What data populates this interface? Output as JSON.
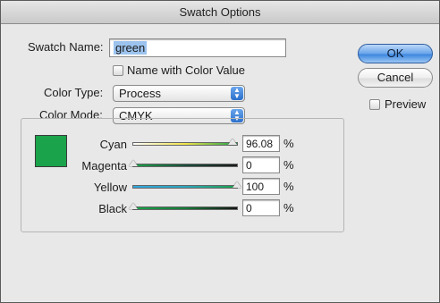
{
  "window": {
    "title": "Swatch Options"
  },
  "swatch_name": {
    "label": "Swatch Name:",
    "value": "green"
  },
  "name_with_color_value": {
    "label": "Name with Color Value",
    "checked": false
  },
  "color_type": {
    "label": "Color Type:",
    "value": "Process"
  },
  "color_mode": {
    "label": "Color Mode:",
    "value": "CMYK"
  },
  "buttons": {
    "ok": "OK",
    "cancel": "Cancel"
  },
  "preview": {
    "label": "Preview",
    "checked": false
  },
  "swatch_color": "#1aa34a",
  "sliders": [
    {
      "label": "Cyan",
      "value": "96.08",
      "unit": "%",
      "fraction": 0.9608,
      "gradient": [
        "#ffffff",
        "#f2e64a",
        "#1aa34a"
      ]
    },
    {
      "label": "Magenta",
      "value": "0",
      "unit": "%",
      "fraction": 0,
      "gradient": [
        "#1aa34a",
        "#1a4d3a",
        "#1a1a1a"
      ]
    },
    {
      "label": "Yellow",
      "value": "100",
      "unit": "%",
      "fraction": 1,
      "gradient": [
        "#33a7e0",
        "#2fa7bf",
        "#1aa34a"
      ]
    },
    {
      "label": "Black",
      "value": "0",
      "unit": "%",
      "fraction": 0,
      "gradient": [
        "#1aa34a",
        "#137a38",
        "#141414"
      ]
    }
  ]
}
